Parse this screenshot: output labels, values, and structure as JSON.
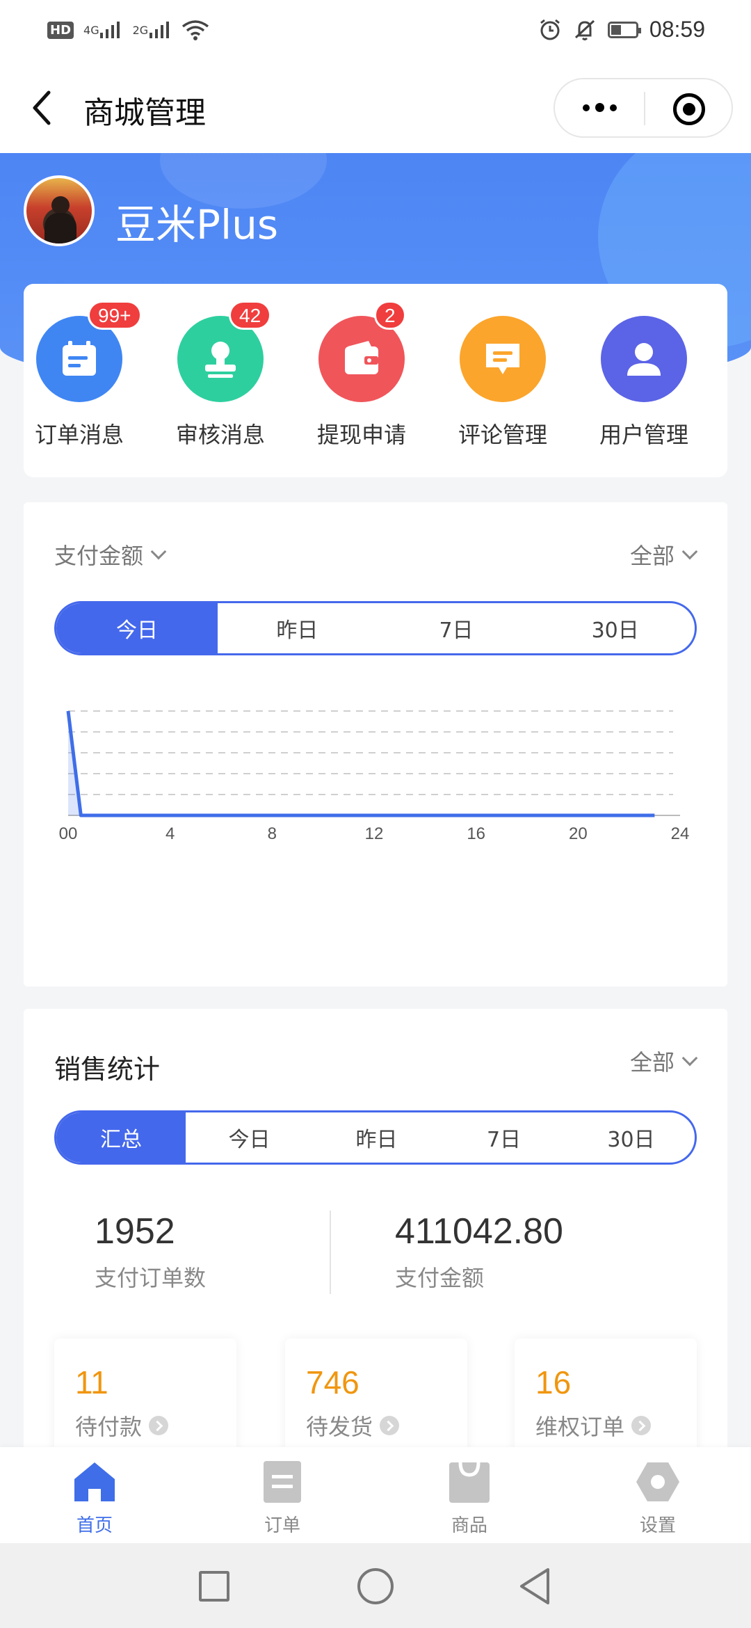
{
  "status_bar": {
    "time": "08:59",
    "hd": "HD",
    "sim1_net": "4G",
    "sim2_net": "2G"
  },
  "nav": {
    "title": "商城管理"
  },
  "shop": {
    "name": "豆米Plus"
  },
  "quick_menu": [
    {
      "label": "订单消息",
      "badge": "99+",
      "color": "#3f86f3",
      "icon": "calendar-icon"
    },
    {
      "label": "审核消息",
      "badge": "42",
      "color": "#2ecf9f",
      "icon": "stamp-icon"
    },
    {
      "label": "提现申请",
      "badge": "2",
      "color": "#f0555a",
      "icon": "wallet-icon"
    },
    {
      "label": "评论管理",
      "badge": "",
      "color": "#fba52c",
      "icon": "comment-icon"
    },
    {
      "label": "用户管理",
      "badge": "",
      "color": "#5b63e6",
      "icon": "user-icon"
    }
  ],
  "chart_section": {
    "metric": "支付金额",
    "filter": "全部",
    "tabs": [
      "今日",
      "昨日",
      "7日",
      "30日"
    ],
    "active_tab": 0
  },
  "chart_data": {
    "type": "area",
    "title": "",
    "xlabel": "",
    "ylabel": "",
    "x_ticks": [
      "00",
      "4",
      "8",
      "12",
      "16",
      "20",
      "24"
    ],
    "xlim": [
      0,
      24
    ],
    "grid": true,
    "series": [
      {
        "x": [
          0,
          0.5,
          1,
          2,
          3,
          4,
          5,
          6,
          7,
          8,
          9,
          10,
          11,
          12,
          13,
          14,
          15,
          16,
          17,
          18,
          19,
          20,
          21,
          22,
          23
        ],
        "values": [
          5,
          0,
          0,
          0,
          0,
          0,
          0,
          0,
          0,
          0,
          0,
          0,
          0,
          0,
          0,
          0,
          0,
          0,
          0,
          0,
          0,
          0,
          0,
          0,
          0
        ]
      }
    ],
    "ylim": [
      0,
      5
    ],
    "color": "#3f6ee8"
  },
  "sales": {
    "title": "销售统计",
    "filter": "全部",
    "tabs": [
      "汇总",
      "今日",
      "昨日",
      "7日",
      "30日"
    ],
    "active_tab": 0,
    "kpis": [
      {
        "value": "1952",
        "label": "支付订单数"
      },
      {
        "value": "411042.80",
        "label": "支付金额"
      }
    ],
    "mini": [
      {
        "value": "11",
        "label": "待付款"
      },
      {
        "value": "746",
        "label": "待发货"
      },
      {
        "value": "16",
        "label": "维权订单"
      }
    ]
  },
  "tabbar": [
    {
      "label": "首页",
      "active": true
    },
    {
      "label": "订单",
      "active": false
    },
    {
      "label": "商品",
      "active": false
    },
    {
      "label": "设置",
      "active": false
    }
  ]
}
